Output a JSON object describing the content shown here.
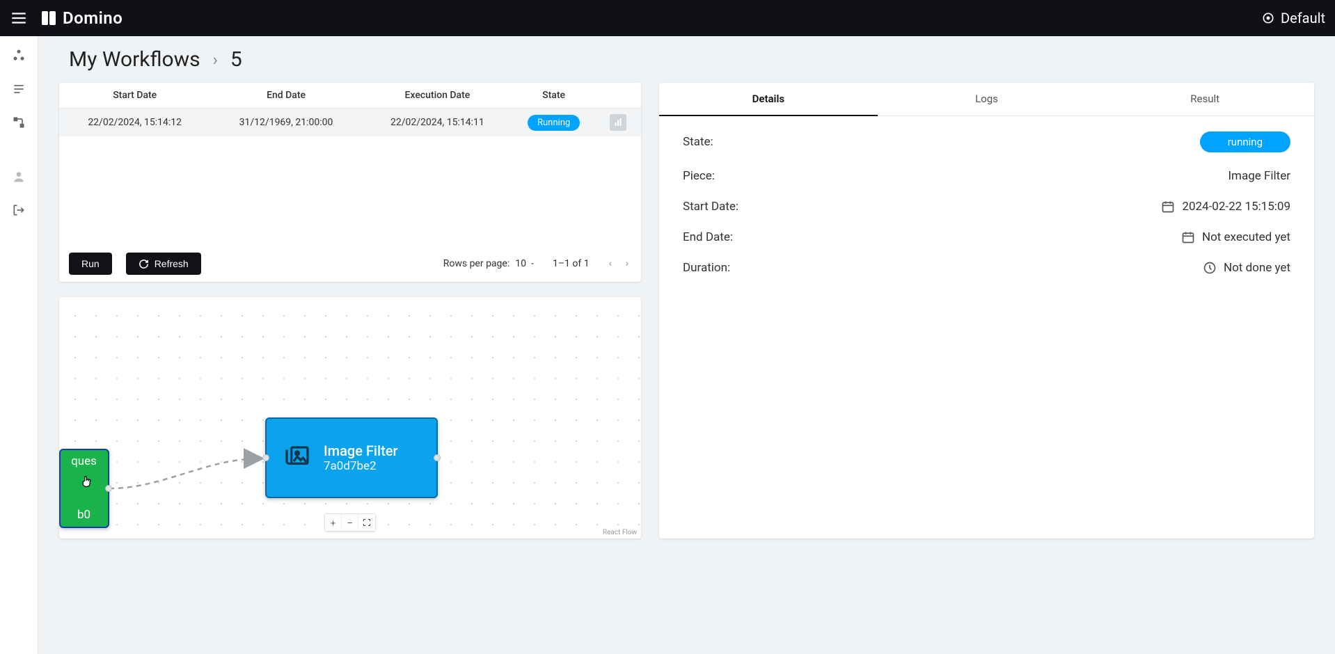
{
  "topbar": {
    "brand": "Domino",
    "workspace": "Default"
  },
  "breadcrumb": {
    "section": "My Workflows",
    "current": "5"
  },
  "runs_table": {
    "headers": {
      "start": "Start Date",
      "end": "End Date",
      "exec": "Execution Date",
      "state": "State"
    },
    "rows": [
      {
        "start": "22/02/2024, 15:14:12",
        "end": "31/12/1969, 21:00:00",
        "exec": "22/02/2024, 15:14:11",
        "state": "Running"
      }
    ],
    "footer": {
      "run_label": "Run",
      "refresh_label": "Refresh",
      "rows_per_page_label": "Rows per page:",
      "rows_per_page_value": "10",
      "range": "1–1 of 1"
    }
  },
  "flow": {
    "node_green": {
      "title_frag": "ques",
      "id_frag": "b0"
    },
    "node_blue": {
      "title": "Image Filter",
      "id": "7a0d7be2"
    },
    "attribution": "React Flow"
  },
  "details": {
    "tabs": {
      "details": "Details",
      "logs": "Logs",
      "result": "Result"
    },
    "state_label": "State:",
    "state_value": "running",
    "piece_label": "Piece:",
    "piece_value": "Image Filter",
    "start_label": "Start Date:",
    "start_value": "2024-02-22 15:15:09",
    "end_label": "End Date:",
    "end_value": "Not executed yet",
    "duration_label": "Duration:",
    "duration_value": "Not done yet"
  }
}
